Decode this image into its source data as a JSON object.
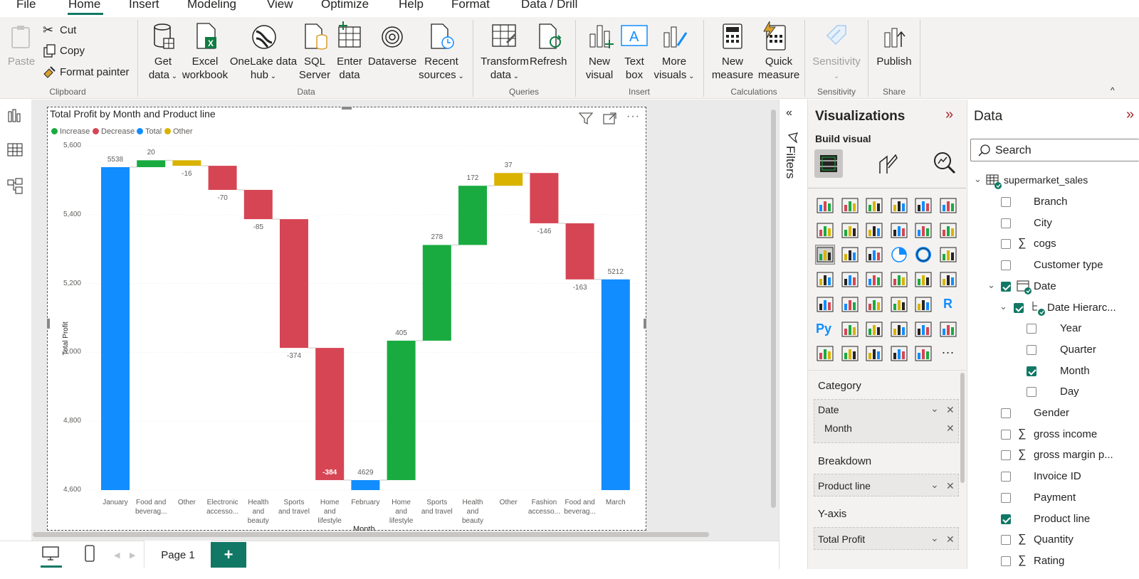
{
  "menu": {
    "tabs": [
      "File",
      "Home",
      "Insert",
      "Modeling",
      "View",
      "Optimize",
      "Help",
      "Format",
      "Data / Drill"
    ],
    "active": "Home"
  },
  "ribbon": {
    "clipboard": {
      "paste": "Paste",
      "cut": "Cut",
      "copy": "Copy",
      "format_painter": "Format painter",
      "group": "Clipboard"
    },
    "data": {
      "get_data": [
        "Get",
        "data"
      ],
      "excel": [
        "Excel",
        "workbook"
      ],
      "onelake": [
        "OneLake data",
        "hub"
      ],
      "sql": [
        "SQL",
        "Server"
      ],
      "enter": [
        "Enter",
        "data"
      ],
      "dataverse": "Dataverse",
      "recent": [
        "Recent",
        "sources"
      ],
      "group": "Data"
    },
    "queries": {
      "transform": [
        "Transform",
        "data"
      ],
      "refresh": "Refresh",
      "group": "Queries"
    },
    "insert": {
      "new_visual": [
        "New",
        "visual"
      ],
      "text_box": [
        "Text",
        "box"
      ],
      "more_visuals": [
        "More",
        "visuals"
      ],
      "group": "Insert"
    },
    "calculations": {
      "new_measure": [
        "New",
        "measure"
      ],
      "quick_measure": [
        "Quick",
        "measure"
      ],
      "group": "Calculations"
    },
    "sensitivity": {
      "label": "Sensitivity",
      "group": "Sensitivity"
    },
    "share": {
      "publish": "Publish",
      "group": "Share"
    }
  },
  "visual": {
    "title": "Total Profit by Month and Product line",
    "legend": [
      {
        "name": "Increase",
        "color": "#1aab40"
      },
      {
        "name": "Decrease",
        "color": "#d64554"
      },
      {
        "name": "Total",
        "color": "#118dff"
      },
      {
        "name": "Other",
        "color": "#d9b300"
      }
    ],
    "ylabel": "Total Profit",
    "xlabel_partial": "Month"
  },
  "chart_data": {
    "type": "waterfall",
    "title": "Total Profit by Month and Product line",
    "ylabel": "Total Profit",
    "xlabel": "Month",
    "ylim": [
      4600,
      5600
    ],
    "yticks": [
      "4,600",
      "4,800",
      "5,000",
      "5,200",
      "5,400",
      "5,600"
    ],
    "steps": [
      {
        "category": [
          "January"
        ],
        "kind": "total",
        "start": 4600,
        "end": 5538,
        "label": "5538"
      },
      {
        "category": [
          "Food and",
          "beverag..."
        ],
        "kind": "increase",
        "start": 5538,
        "end": 5558,
        "label": "20"
      },
      {
        "category": [
          "Other"
        ],
        "kind": "other",
        "start": 5558,
        "end": 5542,
        "label": "-16"
      },
      {
        "category": [
          "Electronic",
          "accesso..."
        ],
        "kind": "decrease",
        "start": 5542,
        "end": 5472,
        "label": "-70"
      },
      {
        "category": [
          "Health",
          "and",
          "beauty"
        ],
        "kind": "decrease",
        "start": 5472,
        "end": 5387,
        "label": "-85"
      },
      {
        "category": [
          "Sports",
          "and travel"
        ],
        "kind": "decrease",
        "start": 5387,
        "end": 5013,
        "label": "-374"
      },
      {
        "category": [
          "Home",
          "and",
          "lifestyle"
        ],
        "kind": "decrease",
        "start": 5013,
        "end": 4629,
        "label": "-384"
      },
      {
        "category": [
          "February"
        ],
        "kind": "total",
        "start": 4600,
        "end": 4629,
        "label": "4629"
      },
      {
        "category": [
          "Home",
          "and",
          "lifestyle"
        ],
        "kind": "increase",
        "start": 4629,
        "end": 5034,
        "label": "405"
      },
      {
        "category": [
          "Sports",
          "and travel"
        ],
        "kind": "increase",
        "start": 5034,
        "end": 5312,
        "label": "278"
      },
      {
        "category": [
          "Health",
          "and",
          "beauty"
        ],
        "kind": "increase",
        "start": 5312,
        "end": 5484,
        "label": "172"
      },
      {
        "category": [
          "Other"
        ],
        "kind": "other",
        "start": 5484,
        "end": 5521,
        "label": "37"
      },
      {
        "category": [
          "Fashion",
          "accesso..."
        ],
        "kind": "decrease",
        "start": 5521,
        "end": 5375,
        "label": "-146"
      },
      {
        "category": [
          "Food and",
          "beverag..."
        ],
        "kind": "decrease",
        "start": 5375,
        "end": 5212,
        "label": "-163"
      },
      {
        "category": [
          "March"
        ],
        "kind": "total",
        "start": 4600,
        "end": 5212,
        "label": "5212"
      }
    ]
  },
  "filters": {
    "label": "Filters"
  },
  "viz_pane": {
    "title": "Visualizations",
    "build_visual": "Build visual",
    "wells": {
      "category_label": "Category",
      "category_fields": [
        "Date",
        "Month"
      ],
      "breakdown_label": "Breakdown",
      "breakdown_field": "Product line",
      "yaxis_label": "Y-axis",
      "yaxis_field": "Total Profit"
    }
  },
  "data_pane": {
    "title": "Data",
    "search_placeholder": "Search",
    "table": "supermarket_sales",
    "fields": [
      {
        "name": "Branch",
        "checked": false,
        "sigma": false,
        "indent": 0
      },
      {
        "name": "City",
        "checked": false,
        "sigma": false,
        "indent": 0
      },
      {
        "name": "cogs",
        "checked": false,
        "sigma": true,
        "indent": 0
      },
      {
        "name": "Customer type",
        "checked": false,
        "sigma": false,
        "indent": 0
      },
      {
        "name": "Date",
        "checked": true,
        "sigma": false,
        "indent": 0,
        "expand": true
      },
      {
        "name": "Date Hierarc...",
        "checked": true,
        "sigma": false,
        "indent": 1,
        "expand": true
      },
      {
        "name": "Year",
        "checked": false,
        "sigma": false,
        "indent": 2
      },
      {
        "name": "Quarter",
        "checked": false,
        "sigma": false,
        "indent": 2
      },
      {
        "name": "Month",
        "checked": true,
        "sigma": false,
        "indent": 2
      },
      {
        "name": "Day",
        "checked": false,
        "sigma": false,
        "indent": 2
      },
      {
        "name": "Gender",
        "checked": false,
        "sigma": false,
        "indent": 0
      },
      {
        "name": "gross income",
        "checked": false,
        "sigma": true,
        "indent": 0
      },
      {
        "name": "gross margin p...",
        "checked": false,
        "sigma": true,
        "indent": 0
      },
      {
        "name": "Invoice ID",
        "checked": false,
        "sigma": false,
        "indent": 0
      },
      {
        "name": "Payment",
        "checked": false,
        "sigma": false,
        "indent": 0
      },
      {
        "name": "Product line",
        "checked": true,
        "sigma": false,
        "indent": 0
      },
      {
        "name": "Quantity",
        "checked": false,
        "sigma": true,
        "indent": 0
      },
      {
        "name": "Rating",
        "checked": false,
        "sigma": true,
        "indent": 0
      }
    ]
  },
  "bottom": {
    "page_tab": "Page 1",
    "add": "+"
  }
}
